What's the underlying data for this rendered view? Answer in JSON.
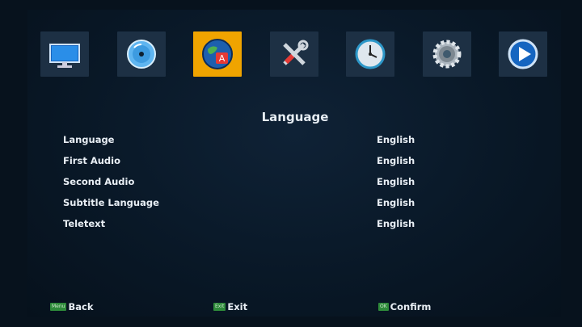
{
  "header": {
    "icons": [
      {
        "name": "tv-monitor-icon"
      },
      {
        "name": "disc-icon"
      },
      {
        "name": "language-globe-icon",
        "selected": true
      },
      {
        "name": "tools-icon"
      },
      {
        "name": "clock-icon"
      },
      {
        "name": "settings-gear-icon"
      },
      {
        "name": "play-icon"
      }
    ],
    "selected_color": "#f0a400"
  },
  "page": {
    "title": "Language"
  },
  "settings": [
    {
      "label": "Language",
      "value": "English"
    },
    {
      "label": "First Audio",
      "value": "English"
    },
    {
      "label": "Second Audio",
      "value": "English"
    },
    {
      "label": "Subtitle Language",
      "value": "English"
    },
    {
      "label": "Teletext",
      "value": "English"
    }
  ],
  "footer": {
    "back": {
      "key": "Menu",
      "label": "Back"
    },
    "exit": {
      "key": "Exit",
      "label": "Exit"
    },
    "confirm": {
      "key": "OK",
      "label": "Confirm"
    }
  }
}
